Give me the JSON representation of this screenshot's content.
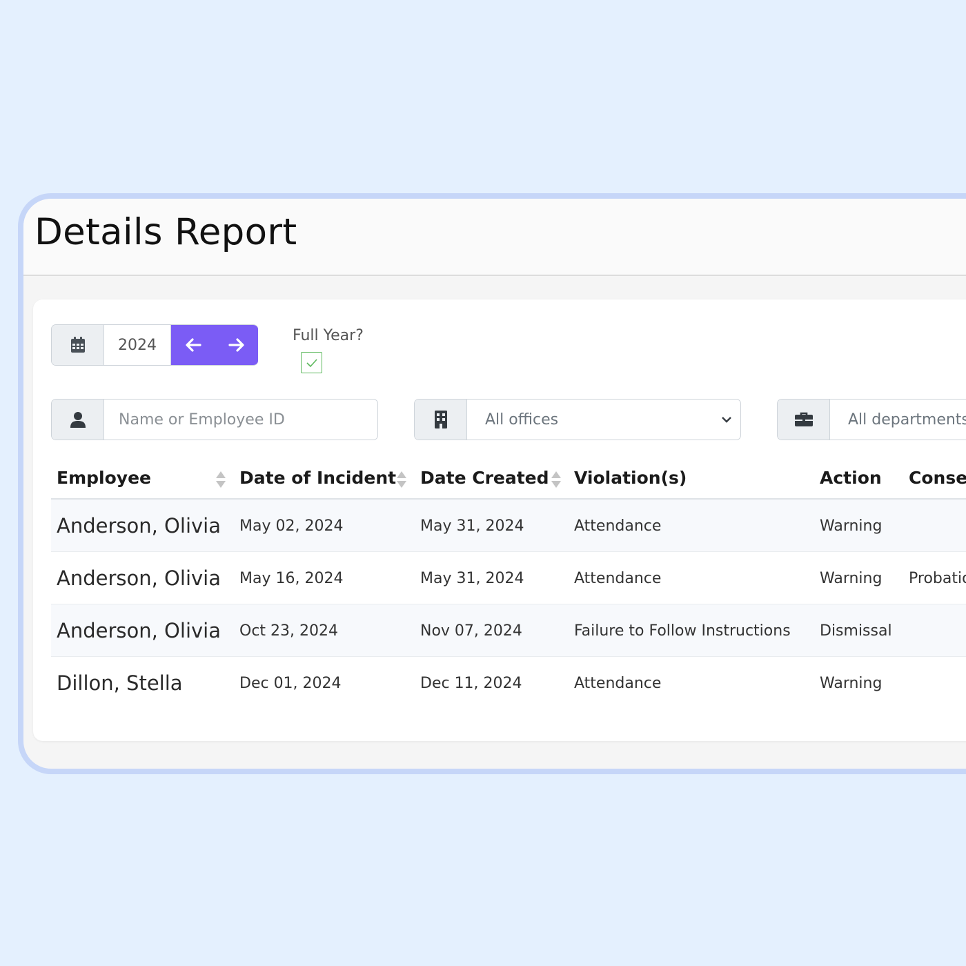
{
  "header": {
    "title": "Details Report"
  },
  "year_control": {
    "year": "2024",
    "prev_label": "previous year",
    "next_label": "next year"
  },
  "full_year": {
    "label": "Full Year?",
    "checked": true
  },
  "filters": {
    "employee_placeholder": "Name or Employee ID",
    "office_selected": "All offices",
    "department_selected": "All departments"
  },
  "table": {
    "columns": [
      "Employee",
      "Date of Incident",
      "Date Created",
      "Violation(s)",
      "Action",
      "Consequence"
    ],
    "rows": [
      {
        "employee": "Anderson, Olivia",
        "incident": "May 02, 2024",
        "created": "May 31, 2024",
        "violation": "Attendance",
        "action": "Warning",
        "consequence": ""
      },
      {
        "employee": "Anderson, Olivia",
        "incident": "May 16, 2024",
        "created": "May 31, 2024",
        "violation": "Attendance",
        "action": "Warning",
        "consequence": "Probation"
      },
      {
        "employee": "Anderson, Olivia",
        "incident": "Oct 23, 2024",
        "created": "Nov 07, 2024",
        "violation": "Failure to Follow Instructions",
        "action": "Dismissal",
        "consequence": ""
      },
      {
        "employee": "Dillon, Stella",
        "incident": "Dec 01, 2024",
        "created": "Dec 11, 2024",
        "violation": "Attendance",
        "action": "Warning",
        "consequence": ""
      }
    ]
  },
  "colors": {
    "accent": "#7b5cf5",
    "check": "#5cb85c",
    "frame": "#c6d6f8",
    "background": "#e4f0fe"
  },
  "icons": [
    "calendar-icon",
    "arrow-left-icon",
    "arrow-right-icon",
    "check-icon",
    "user-icon",
    "building-icon",
    "chevron-down-icon",
    "briefcase-icon",
    "sort-icon"
  ]
}
